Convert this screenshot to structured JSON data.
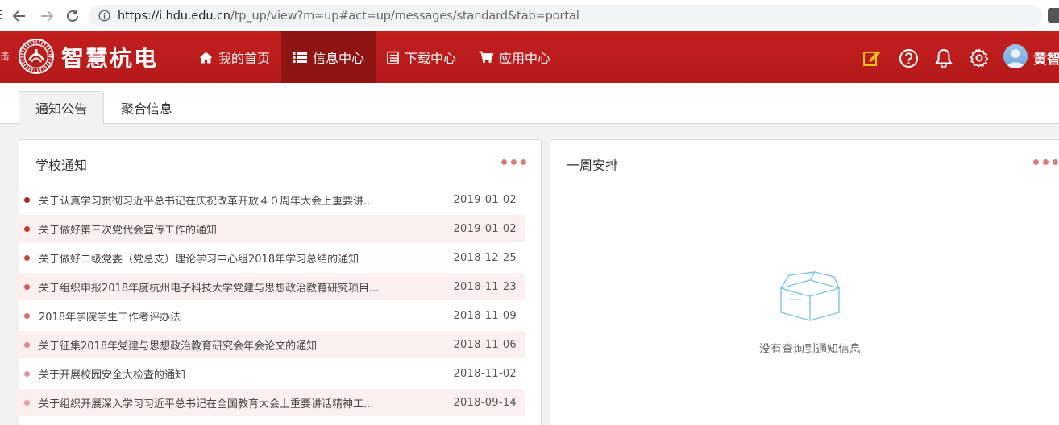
{
  "browser": {
    "url_host": "https://i.hdu.edu.cn",
    "url_path": "/tp_up/view?m=up#act=up/messages/standard&tab=portal"
  },
  "header": {
    "left_strip": "击",
    "brand": "智慧杭电",
    "menu": [
      {
        "label": "我的首页",
        "icon": "home-icon",
        "active": false
      },
      {
        "label": "信息中心",
        "icon": "list-icon",
        "active": true
      },
      {
        "label": "下载中心",
        "icon": "clipboard-icon",
        "active": false
      },
      {
        "label": "应用中心",
        "icon": "cart-icon",
        "active": false
      }
    ],
    "user_name": "黄智",
    "icons": [
      "edit-icon",
      "help-icon",
      "bell-icon",
      "gear-icon"
    ]
  },
  "tabs": [
    {
      "label": "通知公告",
      "active": true
    },
    {
      "label": "聚合信息",
      "active": false
    }
  ],
  "school_notice": {
    "title": "学校通知",
    "items": [
      {
        "title": "关于认真学习贯彻习近平总书记在庆祝改革开放４０周年大会上重要讲...",
        "date": "2019-01-02",
        "bullet": "#b22222"
      },
      {
        "title": "关于做好第三次党代会宣传工作的通知",
        "date": "2019-01-02",
        "bullet": "#c0392b"
      },
      {
        "title": "关于做好二级党委（党总支）理论学习中心组2018年学习总结的通知",
        "date": "2018-12-25",
        "bullet": "#c94444"
      },
      {
        "title": "关于组织申报2018年度杭州电子科技大学党建与思想政治教育研究项目...",
        "date": "2018-11-23",
        "bullet": "#d05a5a"
      },
      {
        "title": "2018年学院学生工作考评办法",
        "date": "2018-11-09",
        "bullet": "#da6f6f"
      },
      {
        "title": "关于征集2018年党建与思想政治教育研究会年会论文的通知",
        "date": "2018-11-06",
        "bullet": "#e08585"
      },
      {
        "title": "关于开展校园安全大检查的通知",
        "date": "2018-11-02",
        "bullet": "#e29595"
      },
      {
        "title": "关于组织开展深入学习习近平总书记在全国教育大会上重要讲话精神工...",
        "date": "2018-09-14",
        "bullet": "#e6a2a2"
      }
    ]
  },
  "weekly": {
    "title": "一周安排",
    "empty_text": "没有查询到通知信息"
  }
}
